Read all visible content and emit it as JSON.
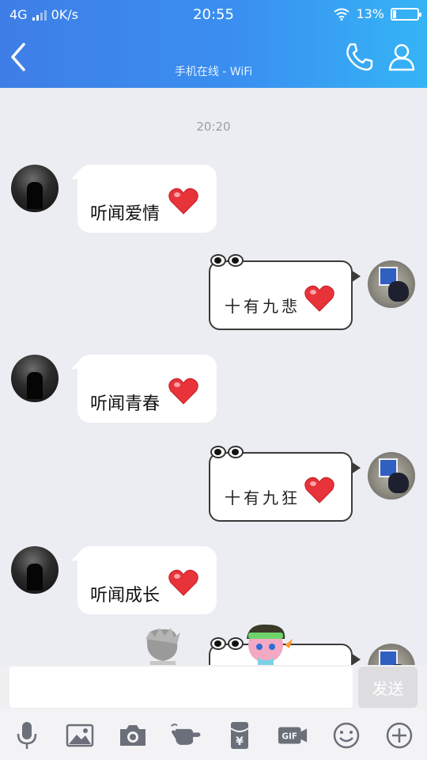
{
  "status_bar": {
    "network": "4G",
    "speed": "0K/s",
    "time": "20:55",
    "battery": "13%"
  },
  "header": {
    "subtitle": "手机在线 - WiFi"
  },
  "chat": {
    "timestamp": "20:20",
    "messages": [
      {
        "side": "left",
        "text": "听闻爱情"
      },
      {
        "side": "right",
        "text": "十有九悲"
      },
      {
        "side": "left",
        "text": "听闻青春"
      },
      {
        "side": "right",
        "text": "十有九狂"
      },
      {
        "side": "left",
        "text": "听闻成长"
      }
    ]
  },
  "input": {
    "value": "",
    "send_label": "发送"
  },
  "toolbar": {
    "gif_label": "GIF",
    "yen_label": "¥"
  },
  "colors": {
    "header_start": "#3e7ee6",
    "header_end": "#35b4f5",
    "chat_bg": "#ebedf2",
    "heart": "#e8333a",
    "send_bg": "#dddde0"
  },
  "icons": [
    "back-arrow-icon",
    "phone-icon",
    "person-icon",
    "microphone-icon",
    "image-icon",
    "camera-icon",
    "poke-hand-icon",
    "red-packet-icon",
    "gif-icon",
    "emoji-icon",
    "plus-icon",
    "heart-icon"
  ]
}
